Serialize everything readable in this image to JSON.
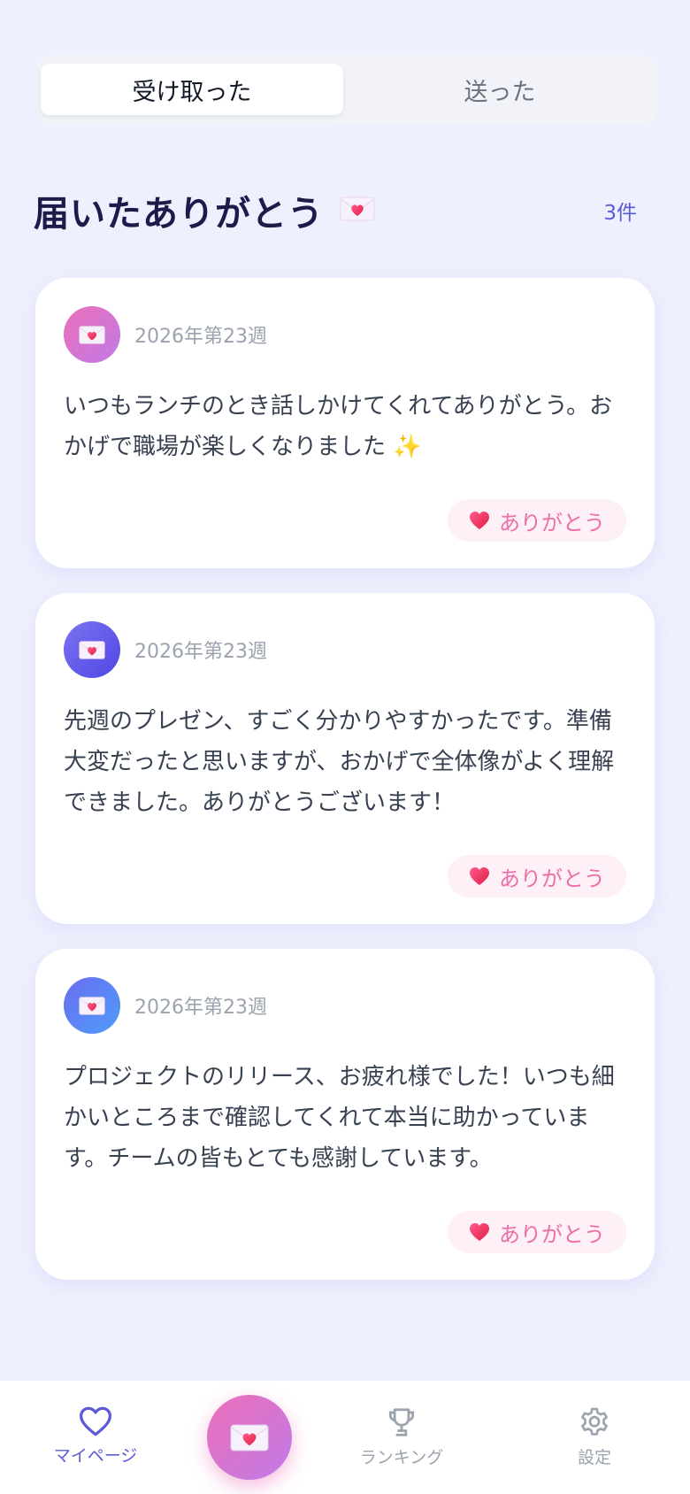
{
  "tabs": [
    {
      "label": "受け取った",
      "active": true
    },
    {
      "label": "送った",
      "active": false
    }
  ],
  "section": {
    "title": "届いたありがとう",
    "count": "3件"
  },
  "cards": [
    {
      "week": "2026年第23週",
      "message": "いつもランチのとき話しかけてくれてありがとう。おかげで職場が楽しくなりました ✨",
      "button_label": "ありがとう",
      "avatar_color": "pink"
    },
    {
      "week": "2026年第23週",
      "message": "先週のプレゼン、すごく分かりやすかったです。準備大変だったと思いますが、おかげで全体像がよく理解できました。ありがとうございます！",
      "button_label": "ありがとう",
      "avatar_color": "indigo"
    },
    {
      "week": "2026年第23週",
      "message": "プロジェクトのリリース、お疲れ様でした！いつも細かいところまで確認してくれて本当に助かっています。チームの皆もとても感謝しています。",
      "button_label": "ありがとう",
      "avatar_color": "blue"
    }
  ],
  "nav": {
    "mypage": "マイページ",
    "ranking": "ランキング",
    "settings": "設定",
    "active": "mypage"
  },
  "colors": {
    "accent": "#5b5bd6",
    "pink": "#ec6fa8",
    "background": "#eef0fd"
  }
}
